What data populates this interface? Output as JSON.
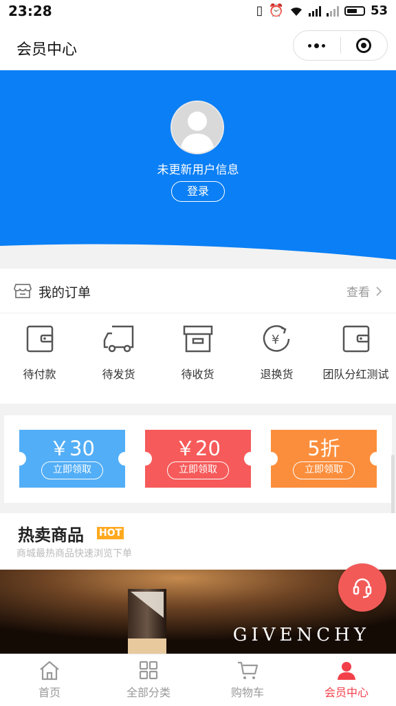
{
  "status_bar": {
    "time": "23:28",
    "battery": "53"
  },
  "nav": {
    "title": "会员中心"
  },
  "profile": {
    "info": "未更新用户信息",
    "login_label": "登录"
  },
  "orders": {
    "title": "我的订单",
    "view_all": "查看",
    "items": [
      {
        "label": "待付款",
        "icon": "wallet-icon"
      },
      {
        "label": "待发货",
        "icon": "truck-icon"
      },
      {
        "label": "待收货",
        "icon": "box-icon"
      },
      {
        "label": "退换货",
        "icon": "yen-refresh-icon"
      },
      {
        "label": "团队分红测试",
        "icon": "wallet-icon"
      }
    ]
  },
  "coupons": [
    {
      "amount": "￥30",
      "button": "立即领取",
      "color": "#52aef7"
    },
    {
      "amount": "￥20",
      "button": "立即领取",
      "color": "#f65a5a"
    },
    {
      "amount": "5折",
      "button": "立即领取",
      "color": "#fb8e3c"
    }
  ],
  "hot": {
    "title": "热卖商品",
    "badge": "HOT",
    "subtitle": "商城最热商品快速浏览下单"
  },
  "banner": {
    "brand": "GIVENCHY"
  },
  "tabs": [
    {
      "label": "首页",
      "icon": "home-icon",
      "active": false
    },
    {
      "label": "全部分类",
      "icon": "grid-icon",
      "active": false
    },
    {
      "label": "购物车",
      "icon": "cart-icon",
      "active": false
    },
    {
      "label": "会员中心",
      "icon": "user-icon",
      "active": true
    }
  ],
  "colors": {
    "header_blue": "#0b7ff5",
    "accent_red": "#f2404a"
  }
}
